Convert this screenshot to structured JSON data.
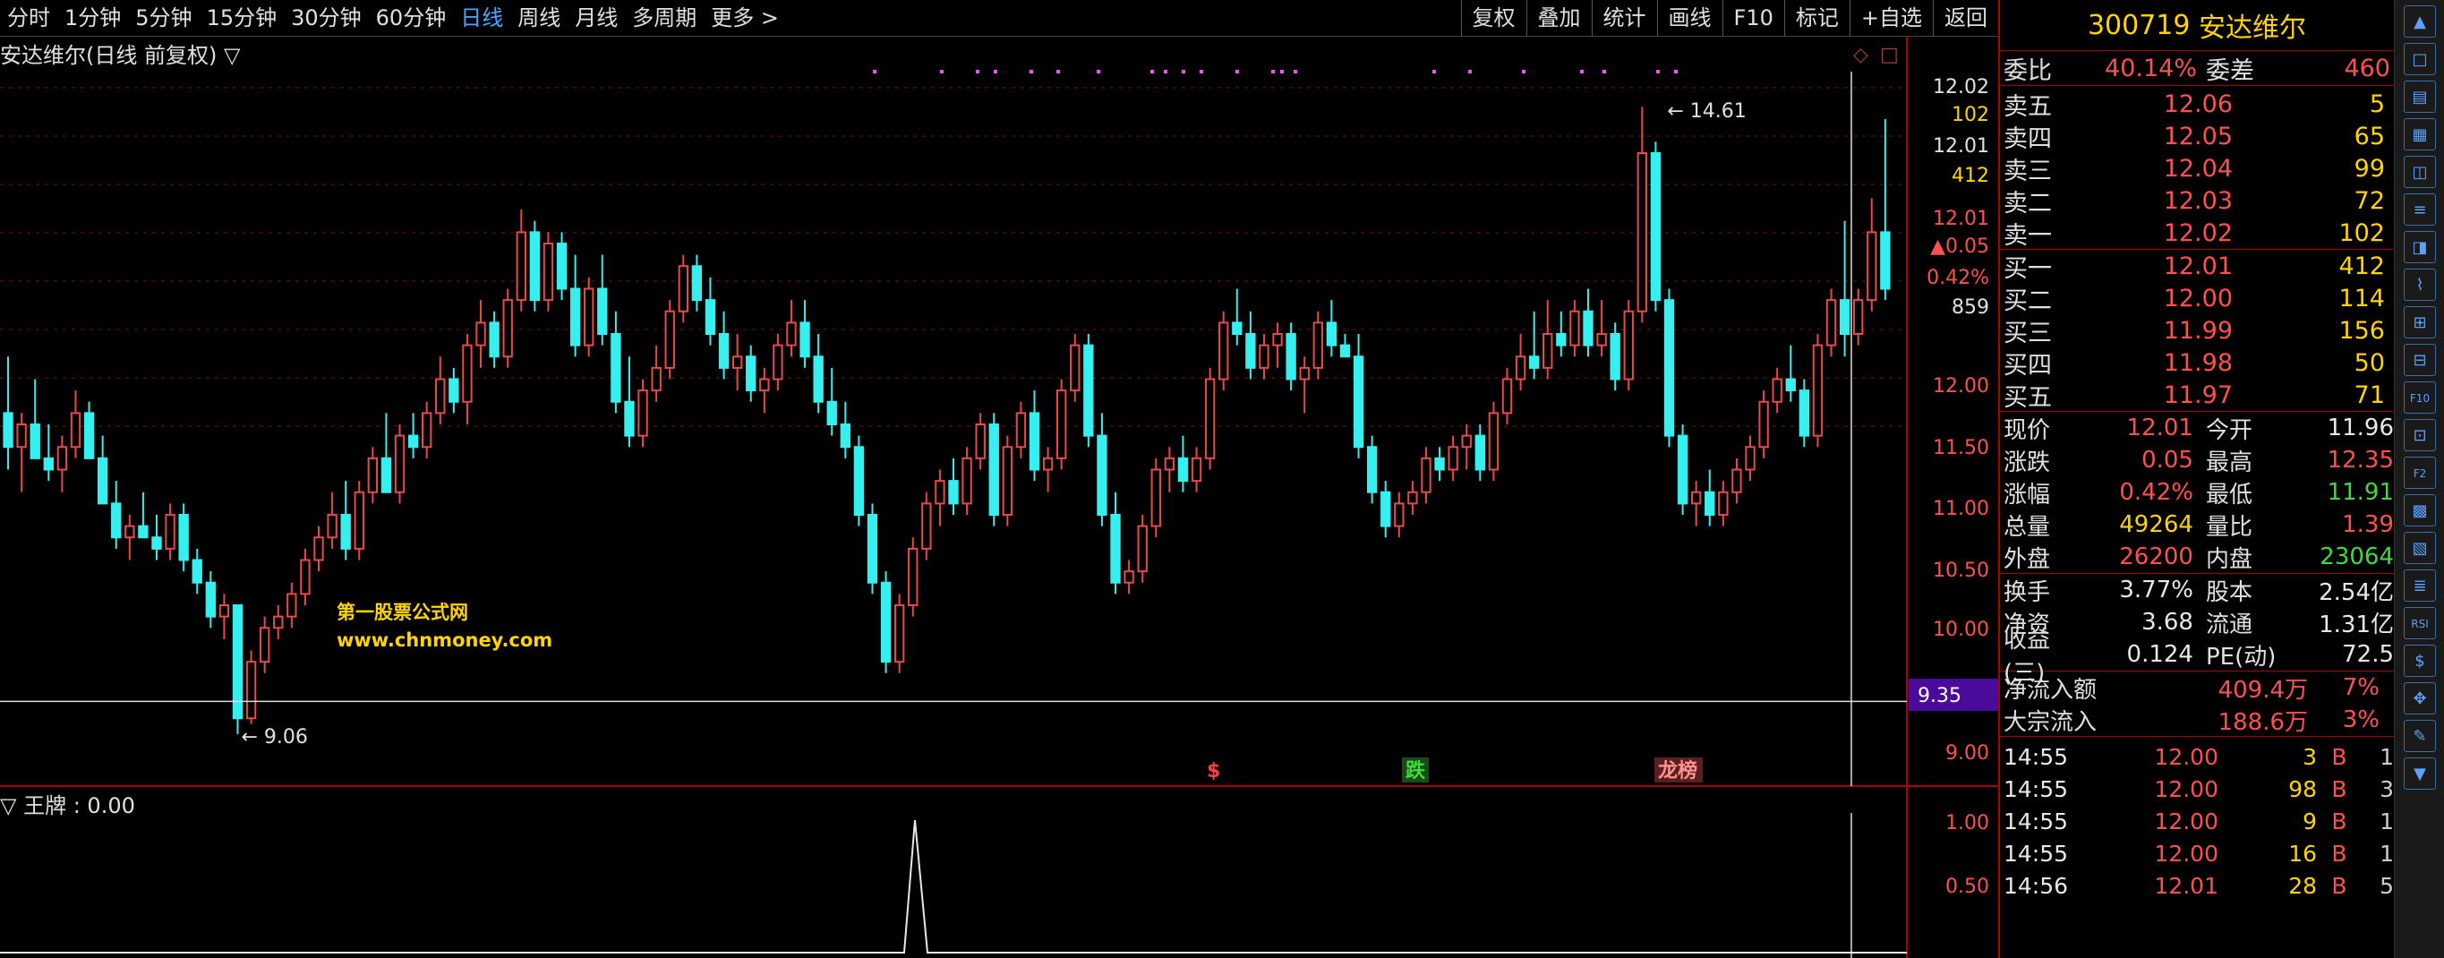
{
  "toolbar": {
    "periods": [
      "分时",
      "1分钟",
      "5分钟",
      "15分钟",
      "30分钟",
      "60分钟",
      "日线",
      "周线",
      "月线",
      "多周期",
      "更多 >"
    ],
    "active_index": 6,
    "buttons": [
      "复权",
      "叠加",
      "统计",
      "画线",
      "F10",
      "标记",
      "+自选",
      "返回"
    ]
  },
  "chart": {
    "title": "安达维尔(日线 前复权) ▽",
    "high_label": "14.61",
    "low_label": "9.06",
    "price_axis": [
      "12.02",
      "102",
      "12.01",
      "412",
      "12.01",
      "▲0.05",
      "0.42%",
      "859",
      "12.00",
      "11.50",
      "11.00",
      "10.50",
      "10.00",
      "9.35",
      "9.00"
    ],
    "markers": [
      "$",
      "跌",
      "龙榜"
    ],
    "watermark_cn": "第一股票公式网",
    "watermark_url": "www.chnmoney.com",
    "up_color": "#e84a4a",
    "down_color": "#36f0f0",
    "candles": [
      [
        11.9,
        12.4,
        11.4,
        11.6
      ],
      [
        11.6,
        11.9,
        11.2,
        11.8
      ],
      [
        11.8,
        12.2,
        11.6,
        11.5
      ],
      [
        11.5,
        11.8,
        11.3,
        11.4
      ],
      [
        11.4,
        11.7,
        11.2,
        11.6
      ],
      [
        11.6,
        12.1,
        11.5,
        11.9
      ],
      [
        11.9,
        12.0,
        11.5,
        11.5
      ],
      [
        11.5,
        11.7,
        11.1,
        11.1
      ],
      [
        11.1,
        11.3,
        10.7,
        10.8
      ],
      [
        10.8,
        11.0,
        10.6,
        10.9
      ],
      [
        10.9,
        11.2,
        10.8,
        10.8
      ],
      [
        10.8,
        11.0,
        10.6,
        10.7
      ],
      [
        10.7,
        11.1,
        10.6,
        11.0
      ],
      [
        11.0,
        11.1,
        10.5,
        10.6
      ],
      [
        10.6,
        10.7,
        10.3,
        10.4
      ],
      [
        10.4,
        10.5,
        10.0,
        10.1
      ],
      [
        10.1,
        10.3,
        9.9,
        10.2
      ],
      [
        10.2,
        10.2,
        9.06,
        9.2
      ],
      [
        9.2,
        9.8,
        9.15,
        9.7
      ],
      [
        9.7,
        10.1,
        9.6,
        10.0
      ],
      [
        10.0,
        10.2,
        9.9,
        10.1
      ],
      [
        10.1,
        10.4,
        10.0,
        10.3
      ],
      [
        10.3,
        10.7,
        10.2,
        10.6
      ],
      [
        10.6,
        10.9,
        10.5,
        10.8
      ],
      [
        10.8,
        11.2,
        10.7,
        11.0
      ],
      [
        11.0,
        11.3,
        10.6,
        10.7
      ],
      [
        10.7,
        11.3,
        10.6,
        11.2
      ],
      [
        11.2,
        11.6,
        11.1,
        11.5
      ],
      [
        11.5,
        11.9,
        11.3,
        11.2
      ],
      [
        11.2,
        11.8,
        11.1,
        11.7
      ],
      [
        11.7,
        11.9,
        11.5,
        11.6
      ],
      [
        11.6,
        12.0,
        11.5,
        11.9
      ],
      [
        11.9,
        12.4,
        11.8,
        12.2
      ],
      [
        12.2,
        12.3,
        11.9,
        12.0
      ],
      [
        12.0,
        12.6,
        11.8,
        12.5
      ],
      [
        12.5,
        12.9,
        12.3,
        12.7
      ],
      [
        12.7,
        12.8,
        12.3,
        12.4
      ],
      [
        12.4,
        13.0,
        12.3,
        12.9
      ],
      [
        12.9,
        13.7,
        12.8,
        13.5
      ],
      [
        13.5,
        13.6,
        12.8,
        12.9
      ],
      [
        12.9,
        13.5,
        12.8,
        13.4
      ],
      [
        13.4,
        13.5,
        12.9,
        13.0
      ],
      [
        13.0,
        13.3,
        12.4,
        12.5
      ],
      [
        12.5,
        13.1,
        12.4,
        13.0
      ],
      [
        13.0,
        13.3,
        12.5,
        12.6
      ],
      [
        12.6,
        12.8,
        11.9,
        12.0
      ],
      [
        12.0,
        12.4,
        11.6,
        11.7
      ],
      [
        11.7,
        12.2,
        11.6,
        12.1
      ],
      [
        12.1,
        12.5,
        12.0,
        12.3
      ],
      [
        12.3,
        12.9,
        12.2,
        12.8
      ],
      [
        12.8,
        13.3,
        12.7,
        13.2
      ],
      [
        13.2,
        13.3,
        12.8,
        12.9
      ],
      [
        12.9,
        13.1,
        12.5,
        12.6
      ],
      [
        12.6,
        12.8,
        12.2,
        12.3
      ],
      [
        12.3,
        12.6,
        12.1,
        12.4
      ],
      [
        12.4,
        12.5,
        12.0,
        12.1
      ],
      [
        12.1,
        12.3,
        11.9,
        12.2
      ],
      [
        12.2,
        12.6,
        12.1,
        12.5
      ],
      [
        12.5,
        12.9,
        12.4,
        12.7
      ],
      [
        12.7,
        12.9,
        12.3,
        12.4
      ],
      [
        12.4,
        12.6,
        11.9,
        12.0
      ],
      [
        12.0,
        12.3,
        11.7,
        11.8
      ],
      [
        11.8,
        12.0,
        11.5,
        11.6
      ],
      [
        11.6,
        11.7,
        10.9,
        11.0
      ],
      [
        11.0,
        11.1,
        10.3,
        10.4
      ],
      [
        10.4,
        10.5,
        9.6,
        9.7
      ],
      [
        9.7,
        10.3,
        9.6,
        10.2
      ],
      [
        10.2,
        10.8,
        10.1,
        10.7
      ],
      [
        10.7,
        11.2,
        10.6,
        11.1
      ],
      [
        11.1,
        11.4,
        10.9,
        11.3
      ],
      [
        11.3,
        11.5,
        11.0,
        11.1
      ],
      [
        11.1,
        11.6,
        11.0,
        11.5
      ],
      [
        11.5,
        11.9,
        11.4,
        11.8
      ],
      [
        11.8,
        11.9,
        10.9,
        11.0
      ],
      [
        11.0,
        11.7,
        10.9,
        11.6
      ],
      [
        11.6,
        12.0,
        11.5,
        11.9
      ],
      [
        11.9,
        12.1,
        11.3,
        11.4
      ],
      [
        11.4,
        11.6,
        11.2,
        11.5
      ],
      [
        11.5,
        12.2,
        11.4,
        12.1
      ],
      [
        12.1,
        12.6,
        12.0,
        12.5
      ],
      [
        12.5,
        12.6,
        11.6,
        11.7
      ],
      [
        11.7,
        11.9,
        10.9,
        11.0
      ],
      [
        11.0,
        11.2,
        10.3,
        10.4
      ],
      [
        10.4,
        10.6,
        10.3,
        10.5
      ],
      [
        10.5,
        11.0,
        10.4,
        10.9
      ],
      [
        10.9,
        11.5,
        10.8,
        11.4
      ],
      [
        11.4,
        11.6,
        11.2,
        11.5
      ],
      [
        11.5,
        11.7,
        11.2,
        11.3
      ],
      [
        11.3,
        11.6,
        11.2,
        11.5
      ],
      [
        11.5,
        12.3,
        11.4,
        12.2
      ],
      [
        12.2,
        12.8,
        12.1,
        12.7
      ],
      [
        12.7,
        13.0,
        12.5,
        12.6
      ],
      [
        12.6,
        12.8,
        12.2,
        12.3
      ],
      [
        12.3,
        12.6,
        12.2,
        12.5
      ],
      [
        12.5,
        12.7,
        12.3,
        12.6
      ],
      [
        12.6,
        12.7,
        12.1,
        12.2
      ],
      [
        12.2,
        12.4,
        11.9,
        12.3
      ],
      [
        12.3,
        12.8,
        12.2,
        12.7
      ],
      [
        12.7,
        12.9,
        12.4,
        12.5
      ],
      [
        12.5,
        12.6,
        12.4,
        12.4
      ],
      [
        12.4,
        12.6,
        11.5,
        11.6
      ],
      [
        11.6,
        11.7,
        11.1,
        11.2
      ],
      [
        11.2,
        11.3,
        10.8,
        10.9
      ],
      [
        10.9,
        11.2,
        10.8,
        11.1
      ],
      [
        11.1,
        11.3,
        11.0,
        11.2
      ],
      [
        11.2,
        11.6,
        11.1,
        11.5
      ],
      [
        11.5,
        11.6,
        11.3,
        11.4
      ],
      [
        11.4,
        11.7,
        11.3,
        11.6
      ],
      [
        11.6,
        11.8,
        11.4,
        11.7
      ],
      [
        11.7,
        11.8,
        11.3,
        11.4
      ],
      [
        11.4,
        12.0,
        11.3,
        11.9
      ],
      [
        11.9,
        12.3,
        11.8,
        12.2
      ],
      [
        12.2,
        12.6,
        12.1,
        12.4
      ],
      [
        12.4,
        12.8,
        12.2,
        12.3
      ],
      [
        12.3,
        12.9,
        12.2,
        12.6
      ],
      [
        12.6,
        12.8,
        12.4,
        12.5
      ],
      [
        12.5,
        12.9,
        12.4,
        12.8
      ],
      [
        12.8,
        13.0,
        12.4,
        12.5
      ],
      [
        12.5,
        12.9,
        12.4,
        12.6
      ],
      [
        12.6,
        12.7,
        12.1,
        12.2
      ],
      [
        12.2,
        12.9,
        12.1,
        12.8
      ],
      [
        12.8,
        14.61,
        12.7,
        14.2
      ],
      [
        14.2,
        14.3,
        12.8,
        12.9
      ],
      [
        12.9,
        13.0,
        11.6,
        11.7
      ],
      [
        11.7,
        11.8,
        11.0,
        11.1
      ],
      [
        11.1,
        11.3,
        10.9,
        11.2
      ],
      [
        11.2,
        11.4,
        10.9,
        11.0
      ],
      [
        11.0,
        11.3,
        10.9,
        11.2
      ],
      [
        11.2,
        11.5,
        11.1,
        11.4
      ],
      [
        11.4,
        11.7,
        11.3,
        11.6
      ],
      [
        11.6,
        12.1,
        11.5,
        12.0
      ],
      [
        12.0,
        12.3,
        11.9,
        12.2
      ],
      [
        12.2,
        12.5,
        12.0,
        12.1
      ],
      [
        12.1,
        12.2,
        11.6,
        11.7
      ],
      [
        11.7,
        12.6,
        11.6,
        12.5
      ],
      [
        12.5,
        13.0,
        12.4,
        12.9
      ],
      [
        12.9,
        13.6,
        12.4,
        12.6
      ],
      [
        12.6,
        13.0,
        12.5,
        12.9
      ],
      [
        12.9,
        13.8,
        12.8,
        13.5
      ],
      [
        13.5,
        14.5,
        12.9,
        13.0
      ]
    ]
  },
  "indicator": {
    "title": "▽ 王牌 : 0.00",
    "axis": [
      "1.00",
      "0.50"
    ]
  },
  "panel": {
    "code": "300719",
    "name": "安达维尔",
    "weibi_label": "委比",
    "weibi": "40.14%",
    "weicha_label": "委差",
    "weicha": "460",
    "sell": [
      {
        "label": "卖五",
        "price": "12.06",
        "vol": "5"
      },
      {
        "label": "卖四",
        "price": "12.05",
        "vol": "65"
      },
      {
        "label": "卖三",
        "price": "12.04",
        "vol": "99"
      },
      {
        "label": "卖二",
        "price": "12.03",
        "vol": "72"
      },
      {
        "label": "卖一",
        "price": "12.02",
        "vol": "102"
      }
    ],
    "buy": [
      {
        "label": "买一",
        "price": "12.01",
        "vol": "412"
      },
      {
        "label": "买二",
        "price": "12.00",
        "vol": "114"
      },
      {
        "label": "买三",
        "price": "11.99",
        "vol": "156"
      },
      {
        "label": "买四",
        "price": "11.98",
        "vol": "50"
      },
      {
        "label": "买五",
        "price": "11.97",
        "vol": "71"
      }
    ],
    "quote": [
      {
        "l1": "现价",
        "v1": "12.01",
        "c1": "red",
        "l2": "今开",
        "v2": "11.96",
        "c2": "wht"
      },
      {
        "l1": "涨跌",
        "v1": "0.05",
        "c1": "red",
        "l2": "最高",
        "v2": "12.35",
        "c2": "red"
      },
      {
        "l1": "涨幅",
        "v1": "0.42%",
        "c1": "red",
        "l2": "最低",
        "v2": "11.91",
        "c2": "grn"
      },
      {
        "l1": "总量",
        "v1": "49264",
        "c1": "yel",
        "l2": "量比",
        "v2": "1.39",
        "c2": "red"
      },
      {
        "l1": "外盘",
        "v1": "26200",
        "c1": "red",
        "l2": "内盘",
        "v2": "23064",
        "c2": "grn"
      }
    ],
    "fund": [
      {
        "l1": "换手",
        "v1": "3.77%",
        "l2": "股本",
        "v2": "2.54亿"
      },
      {
        "l1": "净资",
        "v1": "3.68",
        "l2": "流通",
        "v2": "1.31亿"
      },
      {
        "l1": "收益(三)",
        "v1": "0.124",
        "l2": "PE(动)",
        "v2": "72.5"
      }
    ],
    "flow": [
      {
        "label": "净流入额",
        "value": "409.4万",
        "pct": "7%"
      },
      {
        "label": "大宗流入",
        "value": "188.6万",
        "pct": "3%"
      }
    ],
    "ticks": [
      {
        "time": "14:55",
        "price": "12.00",
        "vol": "3",
        "dir": "B",
        "num": "1"
      },
      {
        "time": "14:55",
        "price": "12.00",
        "vol": "98",
        "dir": "B",
        "num": "3"
      },
      {
        "time": "14:55",
        "price": "12.00",
        "vol": "9",
        "dir": "B",
        "num": "1"
      },
      {
        "time": "14:55",
        "price": "12.00",
        "vol": "16",
        "dir": "B",
        "num": "1"
      },
      {
        "time": "14:56",
        "price": "12.01",
        "vol": "28",
        "dir": "B",
        "num": "5"
      }
    ]
  },
  "iconbar": [
    "▲",
    "□",
    "▤",
    "▦",
    "◫",
    "≡",
    "◨",
    "⌇",
    "⊞",
    "⊟",
    "F10",
    "⊡",
    "F2",
    "▩",
    "▧",
    "≣",
    "RSI",
    "$",
    "✥",
    "✎",
    "▼"
  ]
}
